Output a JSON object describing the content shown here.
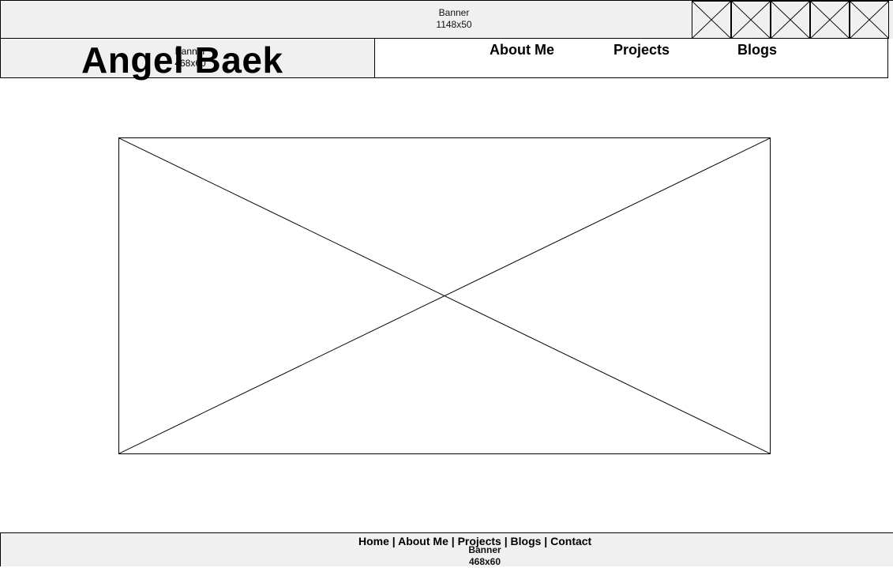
{
  "top_banner": {
    "label": "Banner",
    "size": "1148x50"
  },
  "social_icon_count": 5,
  "header": {
    "title": "Angel Baek",
    "logo_banner": {
      "label": "Banner",
      "size": "468x60"
    }
  },
  "nav": {
    "items": [
      {
        "label": "About Me"
      },
      {
        "label": "Projects"
      },
      {
        "label": "Blogs"
      }
    ]
  },
  "footer": {
    "links": [
      "Home",
      "About Me",
      "Projects",
      "Blogs",
      "Contact"
    ],
    "separator": "|",
    "banner": {
      "label": "Banner",
      "size": "468x60"
    }
  }
}
